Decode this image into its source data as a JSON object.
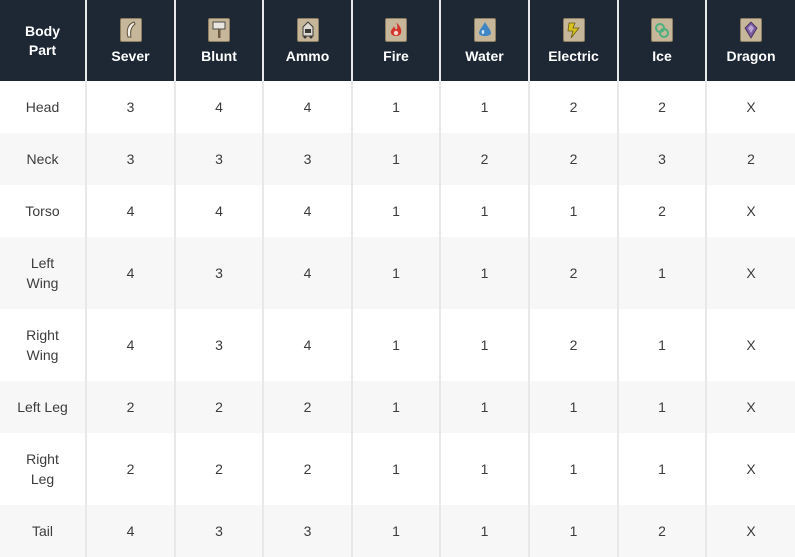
{
  "headers": {
    "body_part": "Body\nPart",
    "sever": "Sever",
    "blunt": "Blunt",
    "ammo": "Ammo",
    "fire": "Fire",
    "water": "Water",
    "electric": "Electric",
    "ice": "Ice",
    "dragon": "Dragon"
  },
  "icons": {
    "sever": "sever-claw-icon",
    "blunt": "blunt-hammer-icon",
    "ammo": "ammo-cart-icon",
    "fire": "fire-flame-icon",
    "water": "water-drop-icon",
    "electric": "electric-bolt-icon",
    "ice": "ice-crystal-icon",
    "dragon": "dragon-gem-icon"
  },
  "colors": {
    "header_bg": "#1d2834",
    "icon_bg": "#c7b79a",
    "fire": "#d2342b",
    "water": "#3f86c4",
    "electric": "#d7c21f",
    "ice": "#4cb07e",
    "dragon": "#7a5aa0"
  },
  "rows": [
    {
      "part": "Head",
      "sever": "3",
      "blunt": "4",
      "ammo": "4",
      "fire": "1",
      "water": "1",
      "electric": "2",
      "ice": "2",
      "dragon": "X"
    },
    {
      "part": "Neck",
      "sever": "3",
      "blunt": "3",
      "ammo": "3",
      "fire": "1",
      "water": "2",
      "electric": "2",
      "ice": "3",
      "dragon": "2"
    },
    {
      "part": "Torso",
      "sever": "4",
      "blunt": "4",
      "ammo": "4",
      "fire": "1",
      "water": "1",
      "electric": "1",
      "ice": "2",
      "dragon": "X"
    },
    {
      "part": "Left\nWing",
      "sever": "4",
      "blunt": "3",
      "ammo": "4",
      "fire": "1",
      "water": "1",
      "electric": "2",
      "ice": "1",
      "dragon": "X"
    },
    {
      "part": "Right\nWing",
      "sever": "4",
      "blunt": "3",
      "ammo": "4",
      "fire": "1",
      "water": "1",
      "electric": "2",
      "ice": "1",
      "dragon": "X"
    },
    {
      "part": "Left Leg",
      "sever": "2",
      "blunt": "2",
      "ammo": "2",
      "fire": "1",
      "water": "1",
      "electric": "1",
      "ice": "1",
      "dragon": "X"
    },
    {
      "part": "Right\nLeg",
      "sever": "2",
      "blunt": "2",
      "ammo": "2",
      "fire": "1",
      "water": "1",
      "electric": "1",
      "ice": "1",
      "dragon": "X"
    },
    {
      "part": "Tail",
      "sever": "4",
      "blunt": "3",
      "ammo": "3",
      "fire": "1",
      "water": "1",
      "electric": "1",
      "ice": "2",
      "dragon": "X"
    }
  ]
}
